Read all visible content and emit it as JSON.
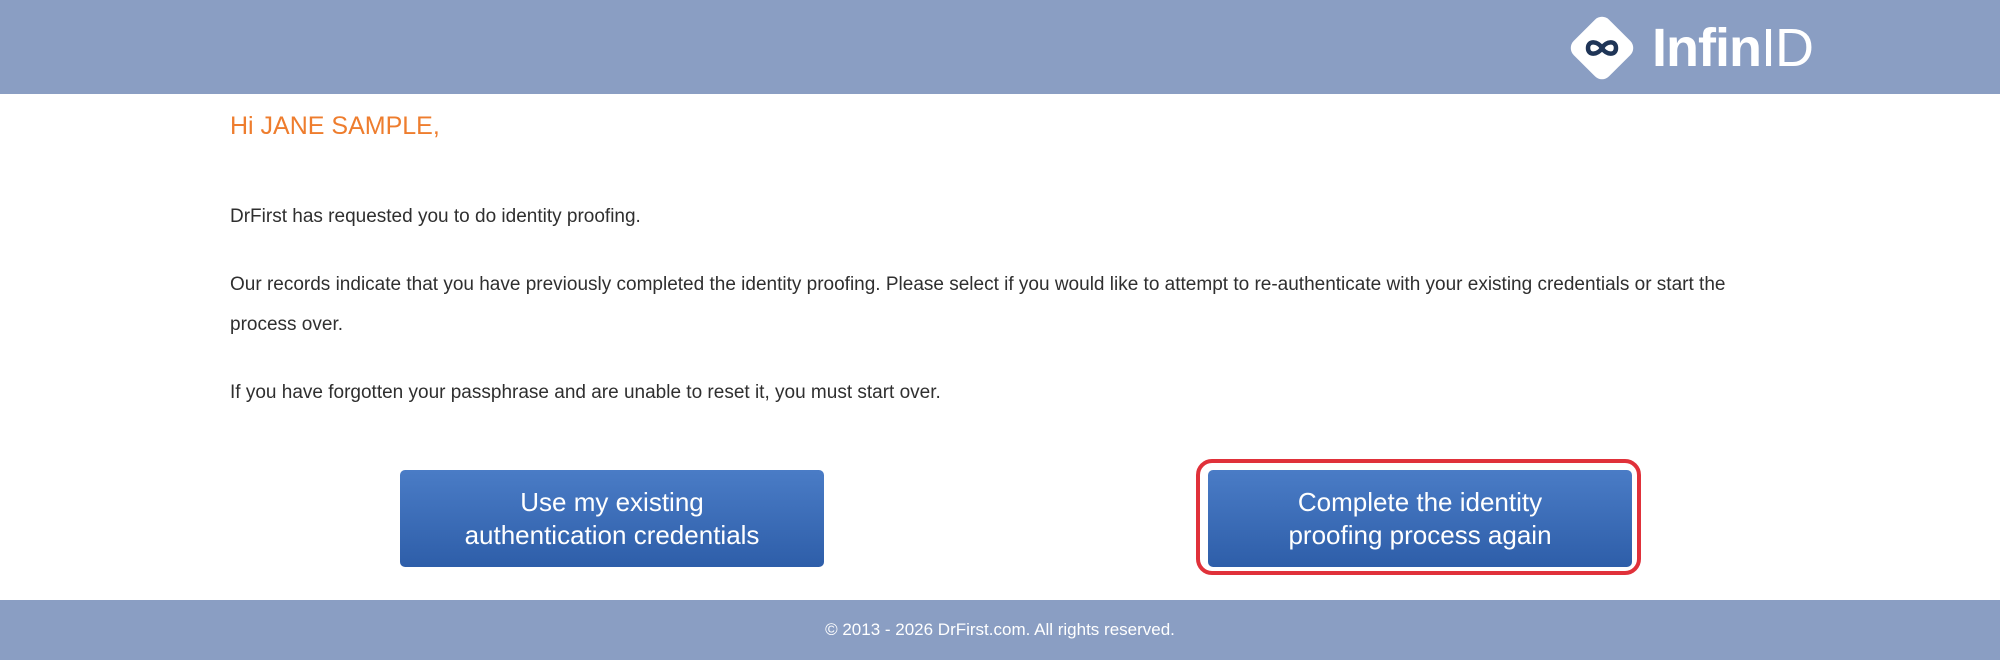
{
  "header": {
    "logo_text_bold": "Infin",
    "logo_text_light": "ID",
    "logo_icon": "infinity-icon"
  },
  "main": {
    "greeting": "Hi JANE SAMPLE,",
    "paragraphs": [
      "DrFirst has requested you to do identity proofing.",
      "Our records indicate that you have previously completed the identity proofing. Please select if you would like to attempt to re-authenticate with your existing credentials or start the process over.",
      "If you have forgotten your passphrase and are unable to reset it, you must start over."
    ],
    "buttons": {
      "existing": {
        "line1": "Use my existing",
        "line2": "authentication credentials"
      },
      "restart": {
        "line1": "Complete the identity",
        "line2": "proofing process again"
      }
    }
  },
  "footer": {
    "copyright": "© 2013 - 2026 DrFirst.com. All rights reserved."
  },
  "colors": {
    "header_bg": "#8a9ec3",
    "greeting": "#ee7d2e",
    "button_bg": "#3d6db8",
    "highlight": "#e0313a"
  }
}
